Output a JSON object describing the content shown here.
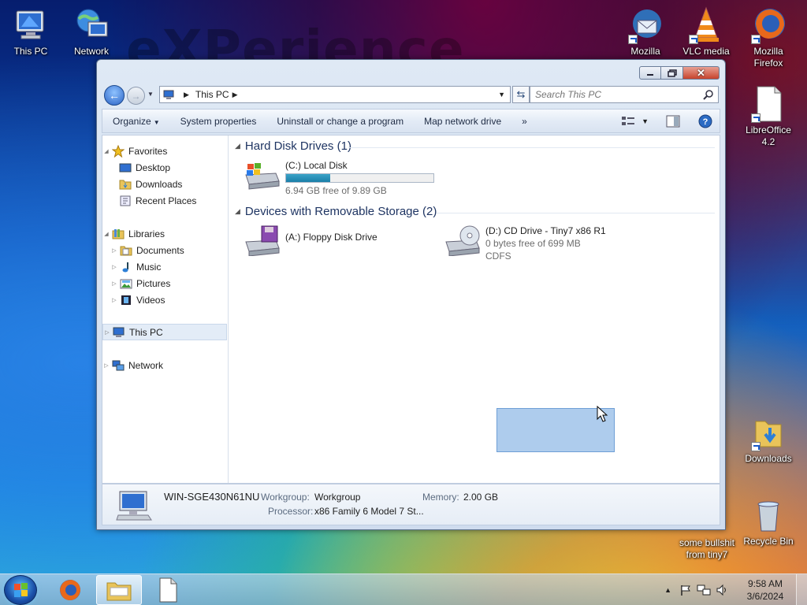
{
  "desktop": {
    "watermark": "eXPerience",
    "icons": {
      "this_pc": "This PC",
      "network": "Network",
      "mozilla": "Mozilla",
      "vlc": "VLC media",
      "firefox": "Mozilla Firefox",
      "libreoffice": "LibreOffice 4.2",
      "downloads": "Downloads",
      "misc": "some bullshit from tiny7",
      "recycle": "Recycle Bin"
    }
  },
  "window": {
    "address": {
      "location": "This PC"
    },
    "search": {
      "placeholder": "Search This PC"
    },
    "toolbar": {
      "organize": "Organize",
      "system_properties": "System properties",
      "uninstall": "Uninstall or change a program",
      "map_drive": "Map network drive",
      "more": "»"
    },
    "nav": {
      "favorites": "Favorites",
      "desktop": "Desktop",
      "downloads": "Downloads",
      "recent": "Recent Places",
      "libraries": "Libraries",
      "documents": "Documents",
      "music": "Music",
      "pictures": "Pictures",
      "videos": "Videos",
      "this_pc": "This PC",
      "network": "Network"
    },
    "groups": {
      "hdd": "Hard Disk Drives (1)",
      "removable": "Devices with Removable Storage (2)"
    },
    "drives": {
      "c": {
        "name": "(C:) Local Disk",
        "free": "6.94 GB free of 9.89 GB",
        "used_fraction": 0.3
      },
      "a": {
        "name": "(A:) Floppy Disk Drive"
      },
      "d": {
        "name": "(D:) CD Drive - Tiny7 x86 R1",
        "free": "0 bytes free of 699 MB",
        "fs": "CDFS"
      }
    },
    "details": {
      "computer_name": "WIN-SGE430N61NU",
      "workgroup_label": "Workgroup:",
      "workgroup": "Workgroup",
      "memory_label": "Memory:",
      "memory": "2.00 GB",
      "processor_label": "Processor:",
      "processor": "x86 Family 6 Model 7 St..."
    }
  },
  "taskbar": {
    "time": "9:58 AM",
    "date": "3/6/2024"
  }
}
